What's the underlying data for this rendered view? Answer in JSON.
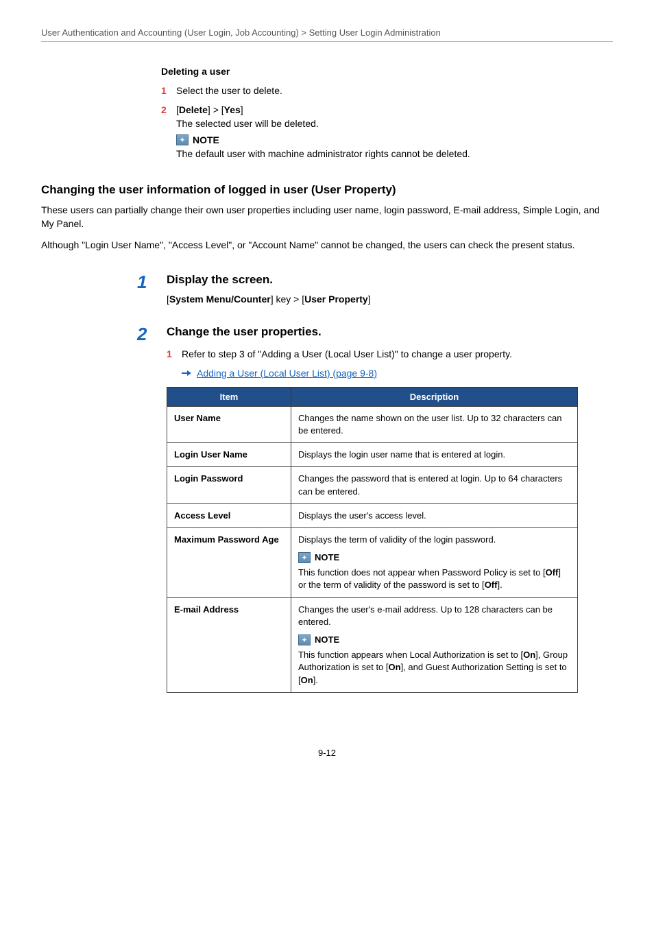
{
  "breadcrumb": "User Authentication and Accounting (User Login, Job Accounting) > Setting User Login Administration",
  "del": {
    "title": "Deleting a user",
    "s1_n": "1",
    "s1": "Select the user to delete.",
    "s2_n": "2",
    "s2": "[Delete] > [Yes]",
    "s2_body": "The selected user will be deleted.",
    "note_label": "NOTE",
    "note_text": "The default user with machine administrator rights cannot be deleted."
  },
  "chg": {
    "title": "Changing the user information of logged in user (User Property)",
    "p1": "These users can partially change their own user properties including user name, login password, E-mail address, Simple Login, and My Panel.",
    "p2": "Although \"Login User Name\", \"Access Level\", or \"Account Name\" cannot be changed, the users can check the present status."
  },
  "bigsteps": {
    "n1": "1",
    "t1": "Display the screen.",
    "t1_body": "[System Menu/Counter] key > [User Property]",
    "n2": "2",
    "t2": "Change the user properties.",
    "sub1_n": "1",
    "sub1": "Refer to step 3 of \"Adding a User (Local User List)\" to change a user property.",
    "link": "Adding a User (Local User List) (page 9-8)"
  },
  "table": {
    "h1": "Item",
    "h2": "Description",
    "r1c1": "User Name",
    "r1c2": "Changes the name shown on the user list. Up to 32 characters can be entered.",
    "r2c1": "Login User Name",
    "r2c2": "Displays the login user name that is entered at login.",
    "r3c1": "Login Password",
    "r3c2": "Changes the password that is entered at login. Up to 64 characters can be entered.",
    "r4c1": "Access Level",
    "r4c2": "Displays the user's access level.",
    "r5c1": "Maximum Password Age",
    "r5c2a": "Displays the term of validity of the login password.",
    "r5_note": "NOTE",
    "r5c2b": "This function does not appear when Password Policy is set to [Off] or the term of validity of the password is set to [Off].",
    "r6c1": "E-mail Address",
    "r6c2a": "Changes the user's e-mail address. Up to 128 characters can be entered.",
    "r6_note": "NOTE",
    "r6c2b": "This function appears when Local Authorization is set to [On], Group Authorization is set to [On], and Guest Authorization Setting is set to [On]."
  },
  "page_num": "9-12"
}
